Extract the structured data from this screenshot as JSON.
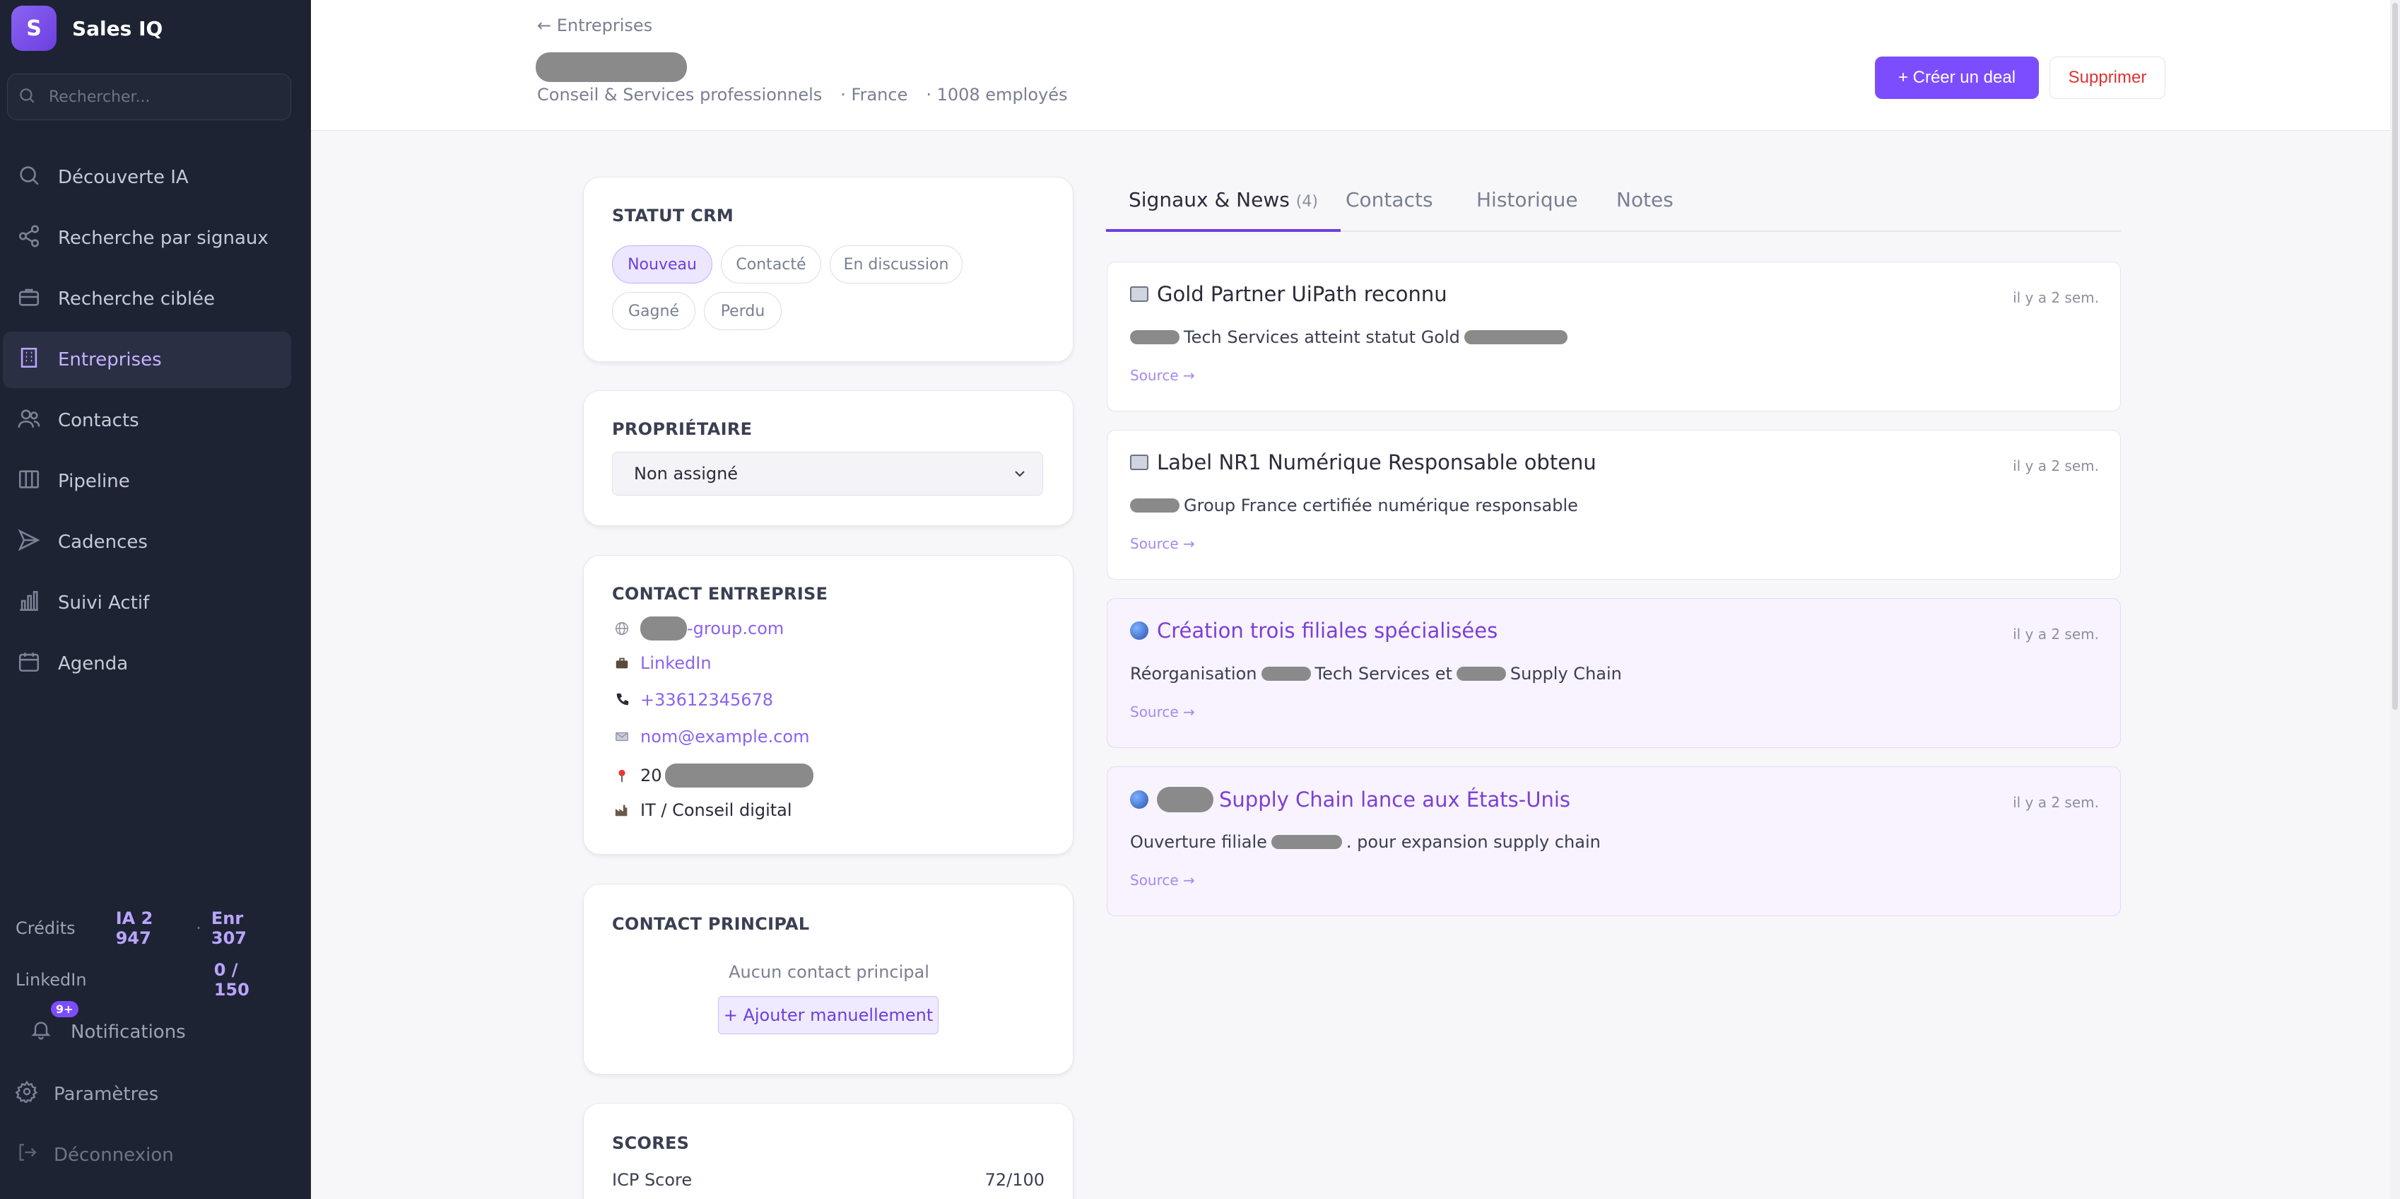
{
  "brand": {
    "logo_letter": "S",
    "name": "Sales IQ"
  },
  "search": {
    "placeholder": "Rechercher..."
  },
  "nav": [
    {
      "label": "Découverte IA",
      "icon": "search-icon"
    },
    {
      "label": "Recherche par signaux",
      "icon": "share-icon"
    },
    {
      "label": "Recherche ciblée",
      "icon": "briefcase-icon"
    },
    {
      "label": "Entreprises",
      "icon": "building-icon",
      "active": true
    },
    {
      "label": "Contacts",
      "icon": "users-icon"
    },
    {
      "label": "Pipeline",
      "icon": "columns-icon"
    },
    {
      "label": "Cadences",
      "icon": "send-icon"
    },
    {
      "label": "Suivi Actif",
      "icon": "bar-chart-icon"
    },
    {
      "label": "Agenda",
      "icon": "calendar-icon"
    }
  ],
  "credits": {
    "label": "Crédits",
    "ia": "IA 2 947",
    "sep": "·",
    "enr": "Enr 307"
  },
  "linkedin_quota": {
    "label": "LinkedIn",
    "value": "0 / 150"
  },
  "notifications": {
    "label": "Notifications",
    "badge": "9+"
  },
  "settings": {
    "label": "Paramètres"
  },
  "logout": {
    "label": "Déconnexion"
  },
  "header": {
    "back": "← Entreprises",
    "sector": "Conseil & Services professionnels",
    "country": "· France",
    "employees": "· 1008 employés",
    "create_deal": "+ Créer un deal",
    "delete": "Supprimer"
  },
  "crm": {
    "title": "STATUT CRM",
    "statuses": [
      "Nouveau",
      "Contacté",
      "En discussion",
      "Gagné",
      "Perdu"
    ],
    "active": "Nouveau"
  },
  "owner": {
    "title": "PROPRIÉTAIRE",
    "value": "Non assigné"
  },
  "company_contact": {
    "title": "CONTACT ENTREPRISE",
    "website_suffix": "-group.com",
    "linkedin": "LinkedIn",
    "phone": "+33612345678",
    "email": "nom@example.com",
    "address_prefix": "20",
    "industry": "IT / Conseil digital"
  },
  "main_contact": {
    "title": "CONTACT PRINCIPAL",
    "empty": "Aucun contact principal",
    "add": "+ Ajouter manuellement"
  },
  "scores": {
    "title": "SCORES",
    "icp_label": "ICP Score",
    "icp_value": "72/100"
  },
  "tabs": [
    {
      "label": "Signaux & News",
      "count": "(4)",
      "active": true
    },
    {
      "label": "Contacts"
    },
    {
      "label": "Historique"
    },
    {
      "label": "Notes"
    }
  ],
  "news": [
    {
      "icon": "newspaper-icon",
      "title": "Gold Partner UiPath reconnu",
      "date": "il y a 2 sem.",
      "desc_a": "Tech Services atteint statut Gold",
      "desc_b": "",
      "source": "Source →",
      "highlight": false
    },
    {
      "icon": "newspaper-icon",
      "title": "Label NR1 Numérique Responsable obtenu",
      "date": "il y a 2 sem.",
      "desc_a": "Group France certifiée numérique responsable",
      "desc_b": "",
      "source": "Source →",
      "highlight": false
    },
    {
      "icon": "globe-icon",
      "title": "Création trois filiales spécialisées",
      "date": "il y a 2 sem.",
      "desc_a": "Réorganisation",
      "desc_b": "Tech Services et",
      "desc_c": "Supply Chain",
      "source": "Source →",
      "highlight": true
    },
    {
      "icon": "globe-icon",
      "title": "Supply Chain lance aux États-Unis",
      "date": "il y a 2 sem.",
      "desc_a": "Ouverture filiale",
      "desc_b": ". pour expansion supply chain",
      "source": "Source →",
      "highlight": true
    }
  ]
}
